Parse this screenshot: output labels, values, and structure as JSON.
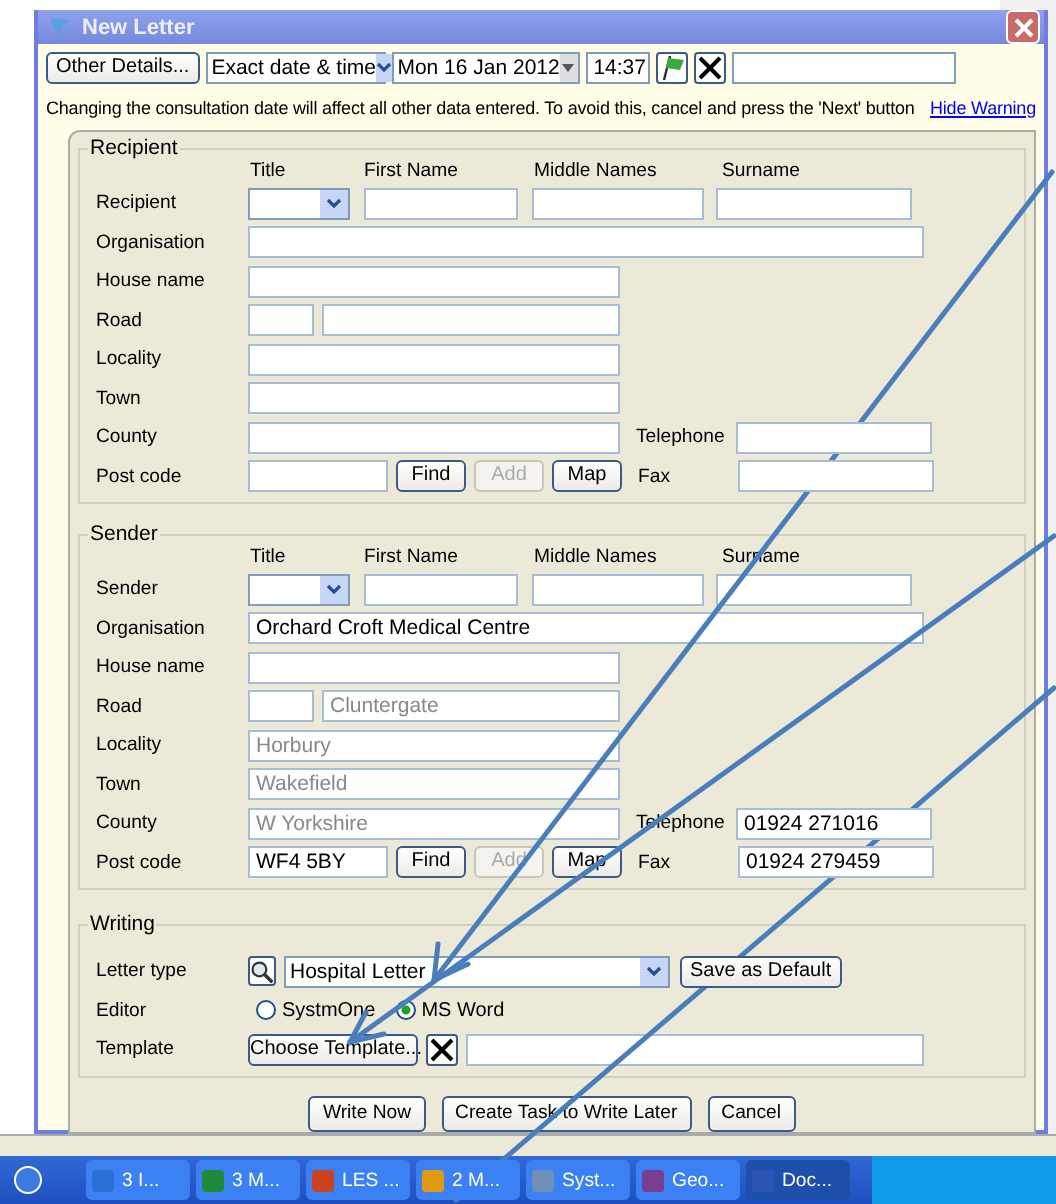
{
  "window": {
    "title": "New Letter"
  },
  "toolbar": {
    "other_details": "Other Details...",
    "date_mode": "Exact date & time",
    "date": "Mon 16 Jan 2012",
    "time": "14:37"
  },
  "warning": {
    "text": "Changing the consultation date will affect all other data entered. To avoid this, cancel and press the 'Next' button",
    "link": "Hide Warning"
  },
  "sections": [
    {
      "title": "Recipient",
      "headers": [
        "Title",
        "First Name",
        "Middle Names",
        "Surname"
      ],
      "rows": [
        {
          "kind": "name",
          "label": "Recipient"
        },
        {
          "kind": "wide",
          "label": "Organisation"
        },
        {
          "kind": "field",
          "label": "House name"
        },
        {
          "kind": "road",
          "label": "Road"
        },
        {
          "kind": "field",
          "label": "Locality"
        },
        {
          "kind": "field",
          "label": "Town"
        },
        {
          "kind": "field",
          "label": "County",
          "side": {
            "label": "Telephone"
          }
        },
        {
          "kind": "postcode",
          "label": "Post code",
          "buttons": [
            {
              "label": "Find",
              "disabled": false
            },
            {
              "label": "Add",
              "disabled": true
            },
            {
              "label": "Map",
              "disabled": false
            }
          ],
          "side": {
            "label": "Fax"
          }
        }
      ]
    },
    {
      "title": "Sender",
      "headers": [
        "Title",
        "First Name",
        "Middle Names",
        "Surname"
      ],
      "rows": [
        {
          "kind": "name",
          "label": "Sender"
        },
        {
          "kind": "wide",
          "label": "Organisation",
          "value": "Orchard Croft Medical Centre"
        },
        {
          "kind": "field",
          "label": "House name"
        },
        {
          "kind": "road",
          "label": "Road",
          "placeholder": "Cluntergate"
        },
        {
          "kind": "field",
          "label": "Locality",
          "placeholder": "Horbury"
        },
        {
          "kind": "field",
          "label": "Town",
          "placeholder": "Wakefield"
        },
        {
          "kind": "field",
          "label": "County",
          "placeholder": "W Yorkshire",
          "side": {
            "label": "Telephone",
            "value": "01924 271016"
          }
        },
        {
          "kind": "postcode",
          "label": "Post code",
          "value": "WF4 5BY",
          "buttons": [
            {
              "label": "Find",
              "disabled": false
            },
            {
              "label": "Add",
              "disabled": true
            },
            {
              "label": "Map",
              "disabled": false
            }
          ],
          "side": {
            "label": "Fax",
            "value": "01924 279459"
          }
        }
      ]
    }
  ],
  "writing": {
    "title": "Writing",
    "letter_type_label": "Letter type",
    "letter_type": "Hospital Letter",
    "save_default": "Save as Default",
    "editor_label": "Editor",
    "editor": [
      {
        "label": "SystmOne",
        "selected": false
      },
      {
        "label": "MS Word",
        "selected": true
      }
    ],
    "template_label": "Template",
    "choose_template": "Choose Template..."
  },
  "buttons": [
    "Write Now",
    "Create Task to Write Later",
    "Cancel"
  ],
  "taskbar": [
    {
      "label": "3 I...",
      "selected": false
    },
    {
      "label": "3 M...",
      "selected": false
    },
    {
      "label": "LES ...",
      "selected": false
    },
    {
      "label": "2 M...",
      "selected": false
    },
    {
      "label": "Syst...",
      "selected": false
    },
    {
      "label": "Geo...",
      "selected": false
    },
    {
      "label": "Doc...",
      "selected": true
    }
  ]
}
